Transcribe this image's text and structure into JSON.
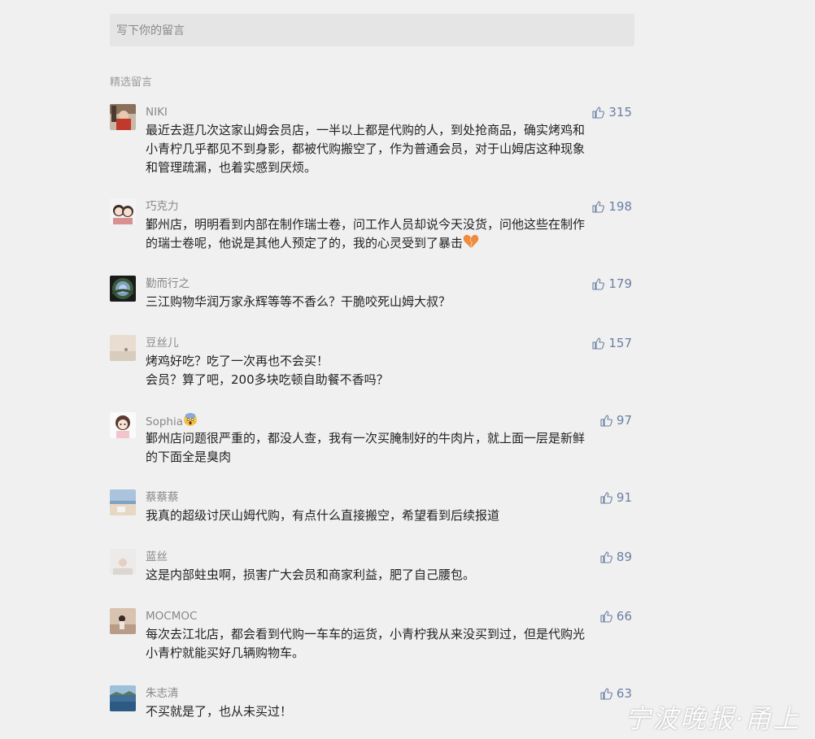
{
  "input": {
    "placeholder": "写下你的留言"
  },
  "section_title": "精选留言",
  "comments": [
    {
      "nick": "NIKI",
      "likes": "315",
      "avatar": "niki-avatar",
      "text": "最近去逛几次这家山姆会员店，一半以上都是代购的人，到处抢商品，确实烤鸡和\n小青柠几乎都见不到身影，都被代购搬空了，作为普通会员，对于山姆店这种现象\n和管理疏漏，也着实感到厌烦。"
    },
    {
      "nick": "巧克力",
      "likes": "198",
      "avatar": "couple-avatar",
      "text": "鄞州店，明明看到内部在制作瑞士卷，问工作人员却说今天没货，问他这些在制作\n的瑞士卷呢，他说是其他人预定了的，我的心灵受到了暴击"
    },
    {
      "nick": "勤而行之",
      "likes": "179",
      "avatar": "globe-avatar",
      "text": "三江购物华润万家永辉等等不香么？干脆咬死山姆大叔？"
    },
    {
      "nick": "豆丝儿",
      "likes": "157",
      "avatar": "beige-avatar",
      "text": "烤鸡好吃？吃了一次再也不会买！\n会员？算了吧，200多块吃顿自助餐不香吗？"
    },
    {
      "nick": "Sophia",
      "likes": "97",
      "avatar": "cartoon-avatar",
      "text": "鄞州店问题很严重的，都没人查，我有一次买腌制好的牛肉片，就上面一层是新鲜\n的下面全是臭肉"
    },
    {
      "nick": "蔡蔡蔡",
      "likes": "91",
      "avatar": "beach-avatar",
      "text": "我真的超级讨厌山姆代购，有点什么直接搬空，希望看到后续报道"
    },
    {
      "nick": "蓝丝",
      "likes": "89",
      "avatar": "pale-avatar",
      "text": "这是内部蛀虫啊，损害广大会员和商家利益，肥了自己腰包。"
    },
    {
      "nick": "MOCMOC",
      "likes": "66",
      "avatar": "girl-avatar",
      "text": "每次去江北店，都会看到代购一车车的运货，小青柠我从来没买到过，但是代购光\n小青柠就能买好几辆购物车。"
    },
    {
      "nick": "朱志清",
      "likes": "63",
      "avatar": "lake-avatar",
      "text": "不买就是了，也从未买过！"
    }
  ],
  "watermark": "宁波晚报·甬上"
}
